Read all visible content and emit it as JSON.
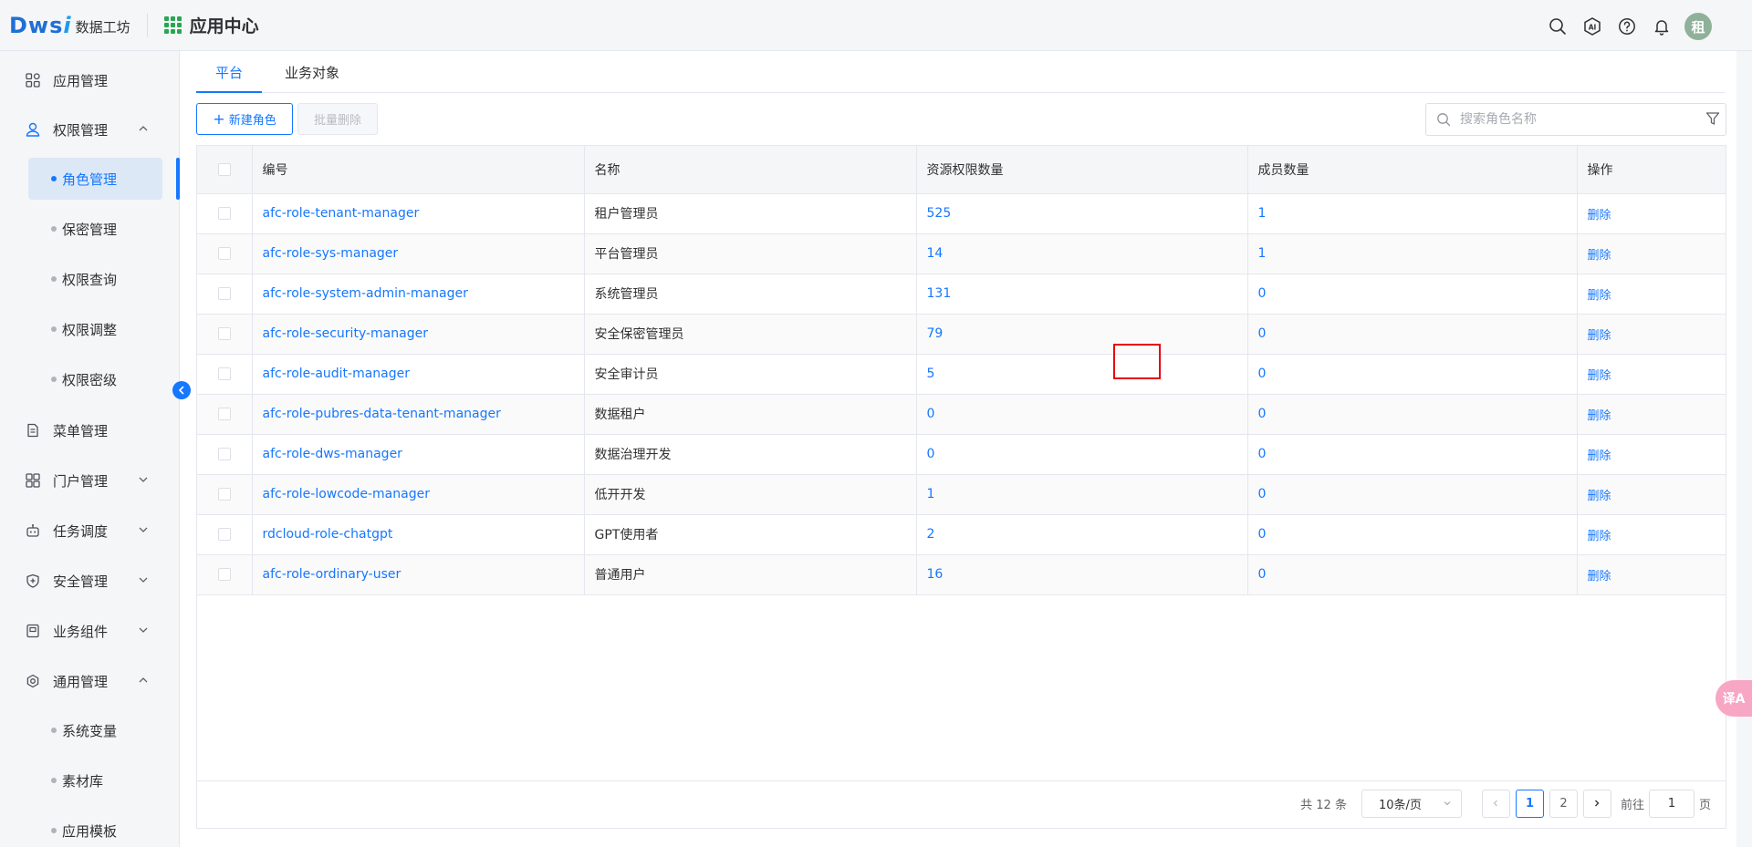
{
  "header": {
    "logo_mark": "Dws",
    "logo_mark_i": "i",
    "logo_text": "数据工坊",
    "app_center_title": "应用中心",
    "avatar_text": "租",
    "icons": [
      "search-icon",
      "ai-icon",
      "help-icon",
      "bell-icon"
    ]
  },
  "sidebar": {
    "items": [
      {
        "label": "应用管理",
        "icon": "app-grid-icon"
      },
      {
        "label": "权限管理",
        "icon": "user-lock-icon",
        "expanded": true,
        "children": [
          {
            "label": "角色管理",
            "active": true
          },
          {
            "label": "保密管理"
          },
          {
            "label": "权限查询"
          },
          {
            "label": "权限调整"
          },
          {
            "label": "权限密级"
          }
        ]
      },
      {
        "label": "菜单管理",
        "icon": "document-icon"
      },
      {
        "label": "门户管理",
        "icon": "portal-icon",
        "expanded": false
      },
      {
        "label": "任务调度",
        "icon": "robot-icon",
        "expanded": false
      },
      {
        "label": "安全管理",
        "icon": "shield-icon",
        "expanded": false
      },
      {
        "label": "业务组件",
        "icon": "component-icon",
        "expanded": false
      },
      {
        "label": "通用管理",
        "icon": "settings-icon",
        "expanded": true,
        "children": [
          {
            "label": "系统变量"
          },
          {
            "label": "素材库"
          },
          {
            "label": "应用模板"
          }
        ]
      }
    ]
  },
  "tabs": [
    {
      "label": "平台",
      "active": true
    },
    {
      "label": "业务对象",
      "active": false
    }
  ],
  "toolbar": {
    "new_role_label": "新建角色",
    "batch_delete_label": "批量删除",
    "search_placeholder": "搜索角色名称"
  },
  "table": {
    "columns": [
      "编号",
      "名称",
      "资源权限数量",
      "成员数量",
      "操作"
    ],
    "rows": [
      {
        "code": "afc-role-tenant-manager",
        "name": "租户管理员",
        "resources": "525",
        "members": "1",
        "action": "删除"
      },
      {
        "code": "afc-role-sys-manager",
        "name": "平台管理员",
        "resources": "14",
        "members": "1",
        "action": "删除"
      },
      {
        "code": "afc-role-system-admin-manager",
        "name": "系统管理员",
        "resources": "131",
        "members": "0",
        "action": "删除"
      },
      {
        "code": "afc-role-security-manager",
        "name": "安全保密管理员",
        "resources": "79",
        "members": "0",
        "action": "删除"
      },
      {
        "code": "afc-role-audit-manager",
        "name": "安全审计员",
        "resources": "5",
        "members": "0",
        "action": "删除"
      },
      {
        "code": "afc-role-pubres-data-tenant-manager",
        "name": "数据租户",
        "resources": "0",
        "members": "0",
        "action": "删除"
      },
      {
        "code": "afc-role-dws-manager",
        "name": "数据治理开发",
        "resources": "0",
        "members": "0",
        "action": "删除"
      },
      {
        "code": "afc-role-lowcode-manager",
        "name": "低开开发",
        "resources": "1",
        "members": "0",
        "action": "删除"
      },
      {
        "code": "rdcloud-role-chatgpt",
        "name": "GPT使用者",
        "resources": "2",
        "members": "0",
        "action": "删除"
      },
      {
        "code": "afc-role-ordinary-user",
        "name": "普通用户",
        "resources": "16",
        "members": "0",
        "action": "删除"
      }
    ]
  },
  "pagination": {
    "total_text": "共 12 条",
    "page_size": "10条/页",
    "pages": [
      "1",
      "2"
    ],
    "current_page": "1",
    "goto_label": "前往",
    "goto_value": "1",
    "page_suffix": "页"
  },
  "translate_widget_text": "译A",
  "colors": {
    "primary": "#1677ff",
    "highlight": "#e60012",
    "logo": "#1f6fd6",
    "grid_icon": "#27a74f"
  }
}
